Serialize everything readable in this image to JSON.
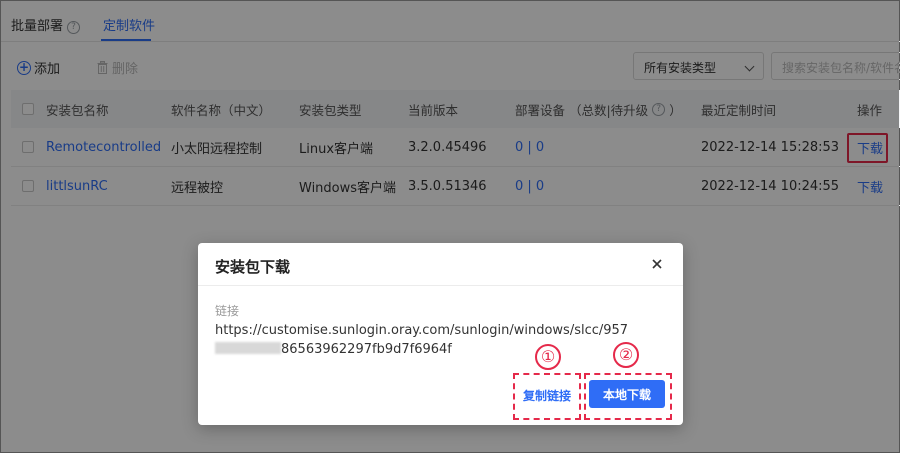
{
  "tabs": [
    {
      "label": "批量部署"
    },
    {
      "label": "定制软件",
      "active": true
    }
  ],
  "help_icon": "?",
  "toolbar": {
    "add_label": "添加",
    "delete_label": "删除",
    "type_select_value": "所有安装类型",
    "search_placeholder": "搜索安装包名称/软件名称"
  },
  "table": {
    "headers": [
      "安装包名称",
      "软件名称（中文）",
      "安装包类型",
      "当前版本",
      "部署设备 （总数|待升级",
      "）",
      "最近定制时间",
      "操作"
    ],
    "rows": [
      {
        "package": "Remotecontrolled",
        "name_cn": "小太阳远程控制",
        "type": "Linux客户端",
        "version": "3.2.0.45496",
        "devices": "0 | 0",
        "time": "2022-12-14 15:28:53",
        "action": "下载"
      },
      {
        "package": "littlsunRC",
        "name_cn": "远程被控",
        "type": "Windows客户端",
        "version": "3.5.0.51346",
        "devices": "0 | 0",
        "time": "2022-12-14 10:24:55",
        "action": "下载"
      }
    ]
  },
  "dialog": {
    "title": "安装包下载",
    "link_label": "链接",
    "link_part1": "https://customise.sunlogin.oray.com/sunlogin/windows/slcc/957",
    "link_part2": "865",
    "link_part3": "63962297fb9d7f6964f",
    "copy_label": "复制链接",
    "local_download_label": "本地下载"
  },
  "annotations": {
    "marker_1": "①",
    "marker_2": "②"
  },
  "colors": {
    "accent": "#2f6df6",
    "highlight": "#e5294a"
  }
}
